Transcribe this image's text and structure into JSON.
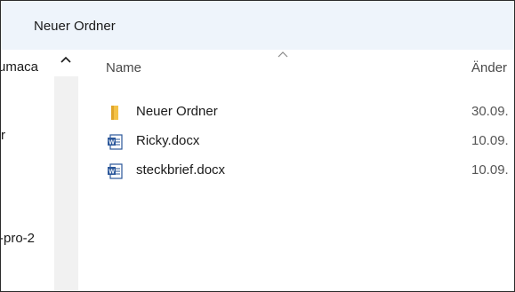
{
  "breadcrumb": {
    "current_folder": "Neuer Ordner"
  },
  "nav_pane": {
    "items": [
      {
        "label": "umaca"
      },
      {
        "label": "r"
      },
      {
        "label": "-pro-2"
      }
    ]
  },
  "columns": {
    "name": "Name",
    "modified": "Änder"
  },
  "files": [
    {
      "name": "Neuer Ordner",
      "date": "30.09.",
      "icon": "folder-icon"
    },
    {
      "name": "Ricky.docx",
      "date": "10.09.",
      "icon": "word-document-icon"
    },
    {
      "name": "steckbrief.docx",
      "date": "10.09.",
      "icon": "word-document-icon"
    }
  ],
  "colors": {
    "header_bg": "#eef4fb",
    "folder_yellow": "#f4c247",
    "word_blue": "#2b579a"
  }
}
